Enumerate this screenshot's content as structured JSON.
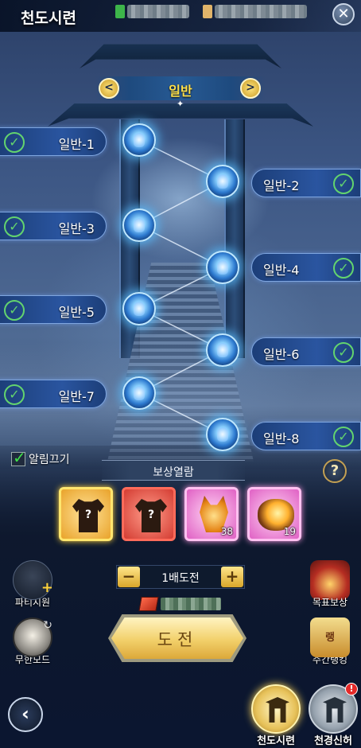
{
  "header": {
    "title": "천도시련",
    "close_label": "✕"
  },
  "difficulty": {
    "label": "일반",
    "prev_label": "<",
    "next_label": ">"
  },
  "stages": [
    {
      "label": "일반-1",
      "side": "left",
      "cleared": true
    },
    {
      "label": "일반-2",
      "side": "right",
      "cleared": true
    },
    {
      "label": "일반-3",
      "side": "left",
      "cleared": true
    },
    {
      "label": "일반-4",
      "side": "right",
      "cleared": true
    },
    {
      "label": "일반-5",
      "side": "left",
      "cleared": true
    },
    {
      "label": "일반-6",
      "side": "right",
      "cleared": true
    },
    {
      "label": "일반-7",
      "side": "left",
      "cleared": true
    },
    {
      "label": "일반-8",
      "side": "right",
      "cleared": true
    }
  ],
  "notification": {
    "label": "알림끄기",
    "checked": true
  },
  "rewards": {
    "title": "보상열람",
    "help_label": "?",
    "items": [
      {
        "icon": "armor-mystery-icon",
        "mystery_label": "?",
        "count": ""
      },
      {
        "icon": "armor-mystery-icon",
        "mystery_label": "?",
        "count": ""
      },
      {
        "icon": "lion-mask-icon",
        "count": "38"
      },
      {
        "icon": "fire-ore-icon",
        "count": "19"
      }
    ]
  },
  "challenge": {
    "multiplier_label": "1배도전",
    "minus_label": "−",
    "plus_label": "+",
    "button_label": "도전"
  },
  "side_buttons": {
    "party_support": "파티지원",
    "infinite_mode": "무한모드",
    "goal_reward": "목표보상",
    "weekly_ranking": "주간랭킹",
    "weekly_ranking_icon_text": "랭"
  },
  "nav": {
    "back_label": "‹",
    "tab_trial": "천도시련",
    "tab_heaven": "천경신허",
    "heaven_badge": "!"
  },
  "colors": {
    "accent_gold": "#ffe04a",
    "check_green": "#63d46e",
    "stage_blue": "#2a55a0"
  }
}
